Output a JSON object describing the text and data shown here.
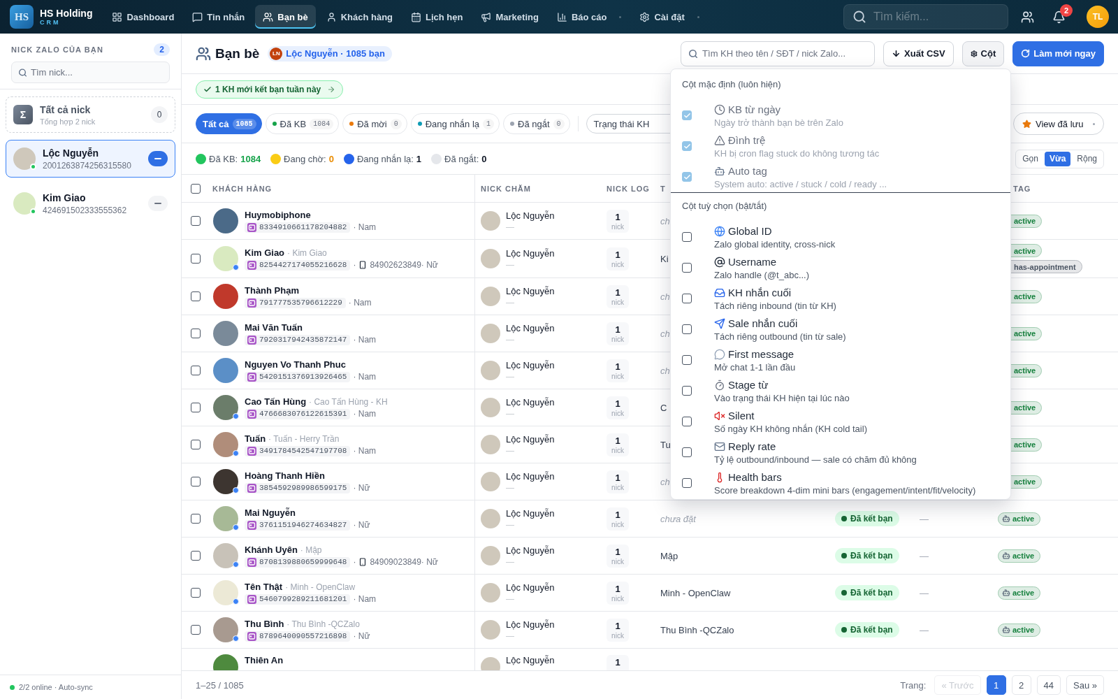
{
  "nav": {
    "logo": {
      "mark": "HS",
      "title": "HS Holding",
      "subtitle": "CRM"
    },
    "items": [
      {
        "label": "Dashboard",
        "selected": false,
        "has_menu": false
      },
      {
        "label": "Tin nhắn",
        "selected": false,
        "has_menu": false
      },
      {
        "label": "Bạn bè",
        "selected": true,
        "has_menu": false
      },
      {
        "label": "Khách hàng",
        "selected": false,
        "has_menu": false
      },
      {
        "label": "Lịch hẹn",
        "selected": false,
        "has_menu": false
      },
      {
        "label": "Marketing",
        "selected": false,
        "has_menu": false
      },
      {
        "label": "Báo cáo",
        "selected": false,
        "has_menu": true
      },
      {
        "label": "Cài đặt",
        "selected": false,
        "has_menu": true
      }
    ],
    "search": {
      "placeholder": "Tìm kiếm..."
    },
    "notifications": "2",
    "user_initials": "TL"
  },
  "sidebar": {
    "heading": "NICK ZALO CỦA BẠN",
    "count": "2",
    "search": {
      "placeholder": "Tìm nick..."
    },
    "all_nicks": {
      "symbol": "Σ",
      "title": "Tất cả nick",
      "subtitle": "Tổng hợp 2 nick",
      "count": "0",
      "selected": false
    },
    "nicks": [
      {
        "name": "Lộc Nguyễn",
        "id": "2001263874256315580",
        "selected": true,
        "online": true
      },
      {
        "name": "Kim Giao",
        "id": "424691502333555362",
        "selected": false,
        "online": true
      }
    ],
    "status": "2/2 online · Auto-sync"
  },
  "header": {
    "title": "Bạn bè",
    "account": {
      "initials": "LN",
      "label": "Lộc Nguyễn · 1085 bạn"
    },
    "search": {
      "placeholder": "Tìm KH theo tên / SĐT / nick Zalo..."
    },
    "actions": [
      {
        "label": "Xuất CSV",
        "kind": "export",
        "pressed": false
      },
      {
        "label": "Cột",
        "kind": "columns",
        "pressed": true
      },
      {
        "label": "Làm mới ngay",
        "kind": "refresh",
        "pressed": false
      }
    ]
  },
  "banner": {
    "text": "1 KH mới kết bạn tuần này"
  },
  "filters": {
    "tabs": [
      {
        "label": "Tất cả",
        "count": "1085",
        "selected": true
      },
      {
        "label": "Đã KB",
        "count": "1084",
        "selected": false,
        "color": "#16a34a"
      },
      {
        "label": "Đã mời",
        "count": "0",
        "selected": false,
        "color": "#ea7a0c"
      },
      {
        "label": "Đang nhắn lạ",
        "count": "1",
        "selected": false,
        "color": "#0e9bb5"
      },
      {
        "label": "Đã ngắt",
        "count": "0",
        "selected": false,
        "color": "#9ca3af"
      }
    ],
    "select": "Trạng thái KH",
    "saved_views": "View đã lưu"
  },
  "legend": [
    {
      "label": "Đã KB:",
      "value": {
        "text": "1084",
        "color": "#16a34a"
      },
      "color": "#22c55e"
    },
    {
      "label": "Đang chờ:",
      "value": {
        "text": "0",
        "color": "#ea8c00"
      },
      "color": "#facc15"
    },
    {
      "label": "Đang nhắn lạ:",
      "value": {
        "text": "1",
        "color": "#111827"
      },
      "color": "#2563eb"
    },
    {
      "label": "Đã ngắt:",
      "value": {
        "text": "0",
        "color": "#111827"
      },
      "color": "#e5e7eb"
    }
  ],
  "density": [
    {
      "label": "Gọn",
      "selected": false
    },
    {
      "label": "Vừa",
      "selected": true
    },
    {
      "label": "Rộng",
      "selected": false
    }
  ],
  "table": {
    "all_checked": false,
    "columns": {
      "customer": "KHÁCH HÀNG",
      "nick": "NICK CHĂM",
      "log": "NICK LOG",
      "column_4": "T",
      "tag": "TAG"
    },
    "rows": [
      {
        "checked": false,
        "name": "Huymobiphone",
        "id": "8334910661178204882",
        "meta": [
          {
            "kind": "text",
            "text": "· Nam"
          }
        ],
        "badge": false,
        "nick": "Lộc Nguyễn",
        "nick_note": "—",
        "log_count": "1",
        "log_unit": "nick",
        "column_4": {
          "text": "ch",
          "unset": true
        },
        "tags": [
          {
            "label": "active",
            "color": "#15803d",
            "kind": "plain"
          }
        ]
      },
      {
        "checked": false,
        "name": "Kim Giao",
        "alias": "· Kim Giao",
        "id": "8254427174055216628",
        "meta": [
          {
            "kind": "text",
            "text": "·"
          },
          {
            "kind": "phone",
            "text": "84902623849· Nữ"
          }
        ],
        "badge": true,
        "nick": "Lộc Nguyễn",
        "nick_note": "—",
        "log_count": "1",
        "log_unit": "nick",
        "column_4": {
          "text": "Ki",
          "unset": false
        },
        "tags": [
          {
            "label": "active",
            "color": "#15803d",
            "kind": "plain"
          },
          {
            "label": "has-appointment",
            "color": "#4b5563",
            "kind": "plain"
          }
        ]
      },
      {
        "checked": false,
        "name": "Thành Phạm",
        "id": "791777535796612229",
        "meta": [
          {
            "kind": "text",
            "text": "· Nam"
          }
        ],
        "badge": false,
        "nick": "Lộc Nguyễn",
        "nick_note": "—",
        "log_count": "1",
        "log_unit": "nick",
        "column_4": {
          "text": "ch",
          "unset": true
        },
        "tags": [
          {
            "label": "active",
            "color": "#15803d",
            "kind": "plain"
          }
        ]
      },
      {
        "checked": false,
        "name": "Mai Văn Tuấn",
        "id": "7920317942435872147",
        "meta": [
          {
            "kind": "text",
            "text": "· Nam"
          }
        ],
        "badge": false,
        "nick": "Lộc Nguyễn",
        "nick_note": "—",
        "log_count": "1",
        "log_unit": "nick",
        "column_4": {
          "text": "ch",
          "unset": true
        },
        "tags": [
          {
            "label": "active",
            "color": "#15803d",
            "kind": "plain"
          }
        ]
      },
      {
        "checked": false,
        "name": "Nguyen Vo Thanh Phuc",
        "id": "5420151376913926465",
        "meta": [
          {
            "kind": "text",
            "text": "· Nam"
          }
        ],
        "badge": false,
        "nick": "Lộc Nguyễn",
        "nick_note": "—",
        "log_count": "1",
        "log_unit": "nick",
        "column_4": {
          "text": "ch",
          "unset": true
        },
        "tags": [
          {
            "label": "active",
            "color": "#15803d",
            "kind": "plain"
          }
        ]
      },
      {
        "checked": false,
        "name": "Cao Tấn Hùng",
        "alias": "· Cao Tấn Hùng - KH",
        "id": "4766683076122615391",
        "meta": [
          {
            "kind": "text",
            "text": "· Nam"
          }
        ],
        "badge": true,
        "nick": "Lộc Nguyễn",
        "nick_note": "—",
        "log_count": "1",
        "log_unit": "nick",
        "column_4": {
          "text": "C",
          "unset": false
        },
        "tags": [
          {
            "label": "active",
            "color": "#15803d",
            "kind": "plain"
          }
        ]
      },
      {
        "checked": false,
        "name": "Tuấn",
        "alias": "· Tuấn - Herry Trần",
        "id": "3491784542547197708",
        "meta": [
          {
            "kind": "text",
            "text": "· Nam"
          }
        ],
        "badge": true,
        "nick": "Lộc Nguyễn",
        "nick_note": "—",
        "log_count": "1",
        "log_unit": "nick",
        "column_4": {
          "text": "Tu",
          "unset": false
        },
        "tags": [
          {
            "label": "active",
            "color": "#15803d",
            "kind": "plain"
          }
        ]
      },
      {
        "checked": false,
        "name": "Hoàng Thanh Hiền",
        "id": "3854592989986599175",
        "meta": [
          {
            "kind": "text",
            "text": "· Nữ"
          }
        ],
        "badge": true,
        "nick": "Lộc Nguyễn",
        "nick_note": "—",
        "log_count": "1",
        "log_unit": "nick",
        "column_4": {
          "text": "ch",
          "unset": true
        },
        "tags": [
          {
            "label": "active",
            "color": "#15803d",
            "kind": "plain"
          }
        ]
      },
      {
        "checked": false,
        "name": "Mai Nguyễn",
        "id": "3761151946274634827",
        "meta": [
          {
            "kind": "text",
            "text": "· Nữ"
          }
        ],
        "badge": true,
        "nick": "Lộc Nguyễn",
        "nick_note": "—",
        "log_count": "1",
        "log_unit": "nick",
        "column_4": {
          "text": "chưa đặt",
          "unset": true
        },
        "status": "Đã kết bạn",
        "column_6": "—",
        "tags": [
          {
            "label": "active",
            "color": "#15803d",
            "kind": "auto"
          }
        ]
      },
      {
        "checked": false,
        "name": "Khánh Uyên",
        "alias": "· Mập",
        "id": "8708139880659999648",
        "meta": [
          {
            "kind": "text",
            "text": "·"
          },
          {
            "kind": "phone",
            "text": "84909023849· Nữ"
          }
        ],
        "badge": true,
        "nick": "Lộc Nguyễn",
        "nick_note": "—",
        "log_count": "1",
        "log_unit": "nick",
        "column_4": {
          "text": "Mập",
          "unset": false
        },
        "status": "Đã kết bạn",
        "column_6": "—",
        "tags": [
          {
            "label": "active",
            "color": "#15803d",
            "kind": "auto"
          }
        ]
      },
      {
        "checked": false,
        "name": "Tên Thật",
        "alias": "· Minh - OpenClaw",
        "id": "5460799289211681201",
        "meta": [
          {
            "kind": "text",
            "text": "· Nam"
          }
        ],
        "badge": true,
        "nick": "Lộc Nguyễn",
        "nick_note": "—",
        "log_count": "1",
        "log_unit": "nick",
        "column_4": {
          "text": "Minh - OpenClaw",
          "unset": false
        },
        "status": "Đã kết bạn",
        "column_6": "—",
        "tags": [
          {
            "label": "active",
            "color": "#15803d",
            "kind": "auto"
          }
        ]
      },
      {
        "checked": false,
        "name": "Thu Bình",
        "alias": "· Thu Bình -QCZalo",
        "id": "8789640090557216898",
        "meta": [
          {
            "kind": "text",
            "text": "· Nữ"
          }
        ],
        "badge": true,
        "nick": "Lộc Nguyễn",
        "nick_note": "—",
        "log_count": "1",
        "log_unit": "nick",
        "column_4": {
          "text": "Thu Bình -QCZalo",
          "unset": false
        },
        "status": "Đã kết bạn",
        "column_6": "—",
        "tags": [
          {
            "label": "active",
            "color": "#15803d",
            "kind": "auto"
          }
        ]
      },
      {
        "name": "Thiên An",
        "nick": "Lộc Nguyễn",
        "log_count": "1"
      }
    ]
  },
  "column_menu": {
    "groups": [
      {
        "title": "Cột mặc định (luôn hiện)",
        "items": [
          {
            "title": "KB từ ngày",
            "description": "Ngày trở thành bạn bè trên Zalo",
            "checked": true,
            "disabled": true
          },
          {
            "title": "Đình trệ",
            "description": "KH bị cron flag stuck do không tương tác",
            "checked": true,
            "disabled": true
          },
          {
            "title": "Auto tag",
            "description": "System auto: active / stuck / cold / ready ...",
            "checked": true,
            "disabled": true
          }
        ]
      },
      {
        "title": "Cột tuỳ chọn (bật/tắt)",
        "items": [
          {
            "title": "Global ID",
            "description": "Zalo global identity, cross-nick",
            "checked": false,
            "disabled": false
          },
          {
            "title": "Username",
            "description": "Zalo handle (@t_abc...)",
            "checked": false,
            "disabled": false
          },
          {
            "title": "KH nhắn cuối",
            "description": "Tách riêng inbound (tin từ KH)",
            "checked": false,
            "disabled": false
          },
          {
            "title": "Sale nhắn cuối",
            "description": "Tách riêng outbound (tin từ sale)",
            "checked": false,
            "disabled": false
          },
          {
            "title": "First message",
            "description": "Mở chat 1-1 lần đầu",
            "checked": false,
            "disabled": false
          },
          {
            "title": "Stage từ",
            "description": "Vào trạng thái KH hiện tại lúc nào",
            "checked": false,
            "disabled": false
          },
          {
            "title": "Silent",
            "description": "Số ngày KH không nhắn (KH cold tail)",
            "checked": false,
            "disabled": false
          },
          {
            "title": "Reply rate",
            "description": "Tỷ lệ outbound/inbound — sale có chăm đủ không",
            "checked": false,
            "disabled": false
          },
          {
            "title": "Health bars",
            "description": "Score breakdown 4-dim mini bars (engagement/intent/fit/velocity)",
            "checked": false,
            "disabled": false
          }
        ]
      }
    ]
  },
  "pagination": {
    "range": "1–25 / 1085",
    "label": "Trang:",
    "pages": [
      {
        "label": "« Trước",
        "selected": false,
        "disabled": true
      },
      {
        "label": "1",
        "selected": true,
        "disabled": false
      },
      {
        "label": "2",
        "selected": false,
        "disabled": false
      },
      {
        "label": "44",
        "selected": false,
        "disabled": false
      },
      {
        "label": "Sau »",
        "selected": false,
        "disabled": false
      }
    ]
  }
}
